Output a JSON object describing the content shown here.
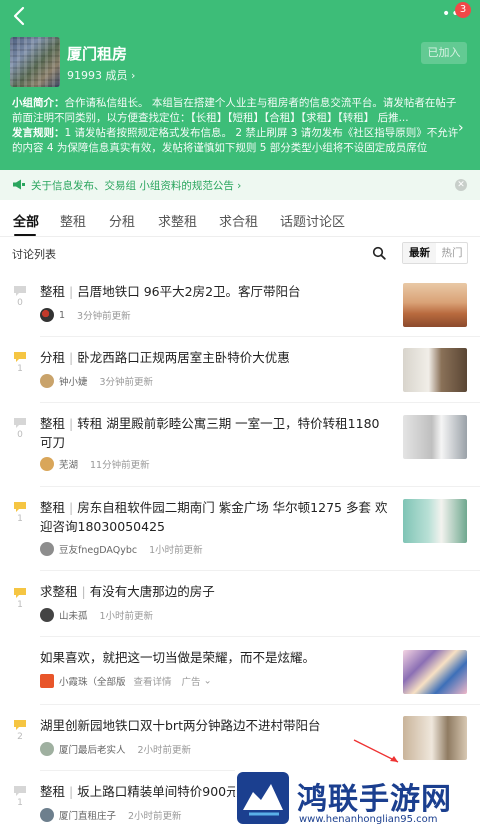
{
  "header": {
    "badge_count": "3",
    "group_name": "厦门租房",
    "members": "91993 成员 ›",
    "joined_label": "已加入",
    "intro_label": "小组简介：",
    "intro_text": "合作请私信组长。 本组旨在搭建个人业主与租房者的信息交流平台。请发帖者在帖子前面注明不同类别，以方便查找定位：【长租】【短租】【合租】【求租】【转租】 后推...",
    "rules_label": "发言规则：",
    "rules_text": "1 请发帖者按照规定格式发布信息。 2 禁止刷屏 3 请勿发布《社区指导原则》不允许的内容 4 为保障信息真实有效，发帖将谨慎如下规则 5 部分类型小组将不设固定成员席位"
  },
  "notice": {
    "text": "关于信息发布、交易组 小组资料的规范公告 ›"
  },
  "tabs": [
    "全部",
    "整租",
    "分租",
    "求整租",
    "求合租",
    "话题讨论区"
  ],
  "list": {
    "title": "讨论列表",
    "sort_new": "最新",
    "sort_hot": "热门"
  },
  "posts": [
    {
      "count": "0",
      "category": "整租",
      "title": "吕厝地铁口 96平大2房2卫。客厅带阳台",
      "user": "1",
      "time": "3分钟前更新"
    },
    {
      "count": "1",
      "category": "分租",
      "title": "卧龙西路口正规两居室主卧特价大优惠",
      "user": "钟小婕",
      "time": "3分钟前更新"
    },
    {
      "count": "0",
      "category": "整租",
      "title": "转租 湖里殿前彰睦公寓三期 一室一卫，特价转租1180可刀",
      "user": "芜湖",
      "time": "11分钟前更新"
    },
    {
      "count": "1",
      "category": "整租",
      "title": "房东自租软件园二期南门 紫金广场 华尔顿1275 多套 欢迎咨询18030050425",
      "user": "豆友fnegDAQybc",
      "time": "1小时前更新"
    },
    {
      "count": "1",
      "category": "求整租",
      "title": "有没有大唐那边的房子",
      "user": "山未孤",
      "time": "1小时前更新"
    },
    {
      "count": "2",
      "category": "",
      "title": "湖里创新园地铁口双十brt两分钟路边不进村带阳台",
      "user": "厦门最后老实人",
      "time": "2小时前更新"
    },
    {
      "count": "1",
      "category": "整租",
      "title": "坂上路口精装单间特价900元",
      "user": "厦门直租庄子",
      "time": "2小时前更新"
    }
  ],
  "ad": {
    "title": "如果喜欢，就把这一切当做是荣耀，而不是炫耀。",
    "brand": "小霞珠（全部版",
    "detail": "查看详情",
    "tag": "广告"
  },
  "watermark": {
    "title": "鸿联手游网",
    "url": "www.henanhonglian95.com"
  }
}
